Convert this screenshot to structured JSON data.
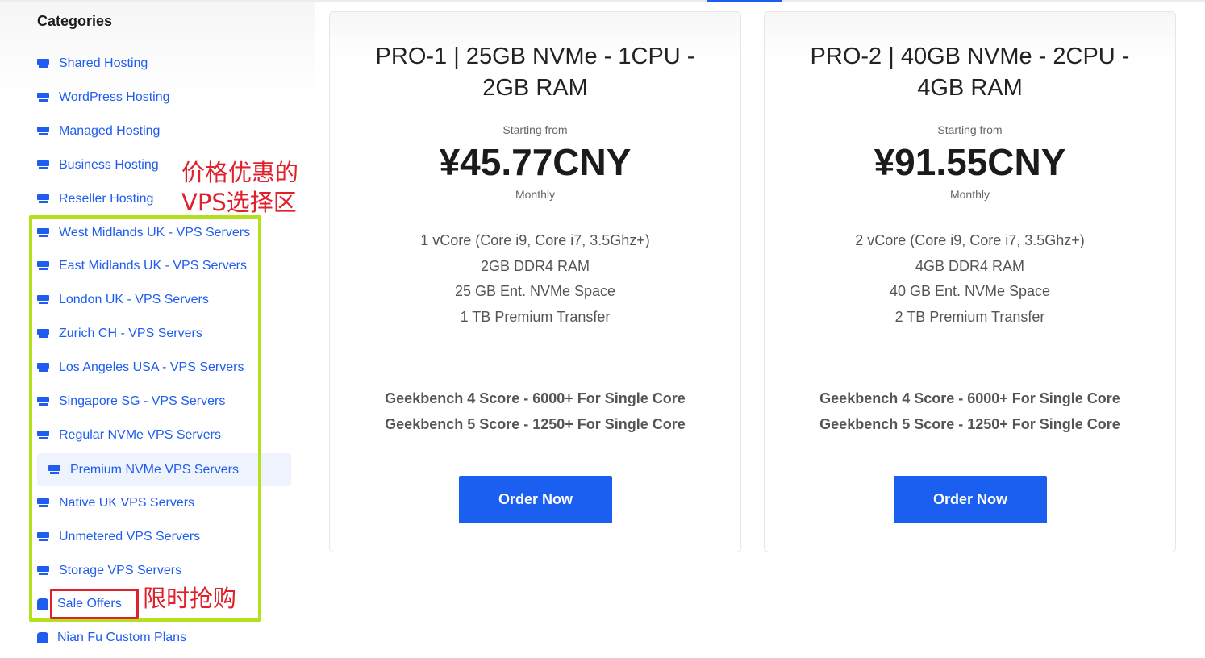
{
  "sidebar": {
    "title": "Categories",
    "items": [
      {
        "label": "Shared Hosting",
        "icon": "server-icon"
      },
      {
        "label": "WordPress Hosting",
        "icon": "server-icon"
      },
      {
        "label": "Managed Hosting",
        "icon": "server-icon"
      },
      {
        "label": "Business Hosting",
        "icon": "server-icon"
      },
      {
        "label": "Reseller Hosting",
        "icon": "server-icon"
      },
      {
        "label": "West Midlands UK - VPS Servers",
        "icon": "server-icon"
      },
      {
        "label": "East Midlands UK - VPS Servers",
        "icon": "server-icon"
      },
      {
        "label": "London UK - VPS Servers",
        "icon": "server-icon"
      },
      {
        "label": "Zurich CH - VPS Servers",
        "icon": "server-icon"
      },
      {
        "label": "Los Angeles USA - VPS Servers",
        "icon": "server-icon"
      },
      {
        "label": "Singapore SG - VPS Servers",
        "icon": "server-icon"
      },
      {
        "label": "Regular NVMe VPS Servers",
        "icon": "server-icon"
      },
      {
        "label": "Premium NVMe VPS Servers",
        "icon": "server-icon",
        "active": true
      },
      {
        "label": "Native UK VPS Servers",
        "icon": "server-icon"
      },
      {
        "label": "Unmetered VPS Servers",
        "icon": "server-icon"
      },
      {
        "label": "Storage VPS Servers",
        "icon": "server-icon"
      },
      {
        "label": "Sale Offers",
        "icon": "shopping-bag-icon"
      },
      {
        "label": "Nian Fu Custom Plans",
        "icon": "shopping-bag-icon"
      }
    ]
  },
  "annotations": {
    "vps_area": "价格优惠的\nVPS选择区",
    "flash_sale": "限时抢购",
    "colors": {
      "green": "#b4e01e",
      "red": "#e0202a"
    }
  },
  "products": [
    {
      "title": "PRO-1 | 25GB NVMe - 1CPU - 2GB RAM",
      "starting_from": "Starting from",
      "price": "¥45.77CNY",
      "cycle": "Monthly",
      "features": [
        "1 vCore (Core i9, Core i7, 3.5Ghz+)",
        "2GB DDR4 RAM",
        "25 GB Ent. NVMe Space",
        "1 TB Premium Transfer"
      ],
      "benchmarks": [
        "Geekbench 4 Score - 6000+ For Single Core",
        "Geekbench 5 Score - 1250+ For Single Core"
      ],
      "order_label": "Order Now"
    },
    {
      "title": "PRO-2 | 40GB NVMe - 2CPU - 4GB RAM",
      "starting_from": "Starting from",
      "price": "¥91.55CNY",
      "cycle": "Monthly",
      "features": [
        "2 vCore (Core i9, Core i7, 3.5Ghz+)",
        "4GB DDR4 RAM",
        "40 GB Ent. NVMe Space",
        "2 TB Premium Transfer"
      ],
      "benchmarks": [
        "Geekbench 4 Score - 6000+ For Single Core",
        "Geekbench 5 Score - 1250+ For Single Core"
      ],
      "order_label": "Order Now"
    }
  ],
  "theme": {
    "accent": "#1a5ff0",
    "link": "#1f5cf0"
  }
}
